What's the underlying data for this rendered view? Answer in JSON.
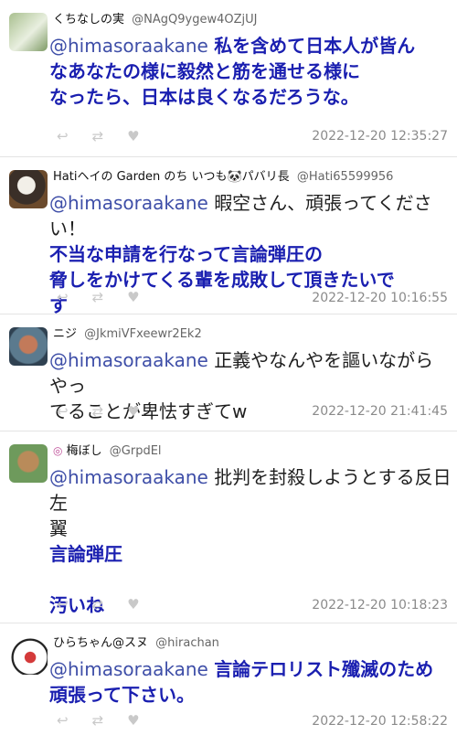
{
  "tweets": [
    {
      "display_name": "くちなしの実",
      "handle": "@NAgQ9ygew4OZjUJ",
      "mention": "@himasoraakane",
      "lines": [
        {
          "bold": true,
          "text": "私を含めて日本人が皆ん"
        },
        {
          "bold": true,
          "text": "なあなたの様に毅然と筋を通せる様に"
        },
        {
          "bold": true,
          "text": "なったら、日本は良くなるだろうな。"
        }
      ],
      "timestamp": "2022-12-20 12:35:27"
    },
    {
      "display_name": "Hatiヘイの Garden のち いつも🐼パバリ長",
      "handle": "@Hati65599956",
      "mention": "@himasoraakane",
      "lines": [
        {
          "bold": false,
          "text": "暇空さん、頑張ってください！"
        },
        {
          "bold": true,
          "text": "不当な申請を行なって言論弾圧の"
        },
        {
          "bold": true,
          "text": "脅しをかけてくる輩を成敗して頂きたいで"
        },
        {
          "bold": true,
          "text": "す"
        }
      ],
      "timestamp": "2022-12-20 10:16:55"
    },
    {
      "display_name": "ニジ",
      "handle": "@JkmiVFxeewr2Ek2",
      "mention": "@himasoraakane",
      "lines": [
        {
          "bold": false,
          "text": "正義やなんやを謳いながらやっ"
        },
        {
          "bold": false,
          "text": "てることが卑怯すぎてw"
        }
      ],
      "timestamp": "2022-12-20 21:41:45"
    },
    {
      "display_name": "梅ぼし",
      "handle": "@GrpdEl",
      "mention": "@himasoraakane",
      "lines": [
        {
          "bold": false,
          "text": "批判を封殺しようとする反日左"
        },
        {
          "bold": false,
          "text": "翼"
        },
        {
          "bold": true,
          "text": "言論弾圧"
        },
        {
          "bold": false,
          "text": ""
        },
        {
          "bold": true,
          "text": "汚いね"
        }
      ],
      "timestamp": "2022-12-20 10:18:23"
    },
    {
      "display_name": "ひらちゃん@スヌ",
      "handle": "@hirachan",
      "mention": "@himasoraakane",
      "lines": [
        {
          "bold": true,
          "text": "言論テロリスト殲滅のため"
        },
        {
          "bold": true,
          "text": "頑張って下さい。"
        }
      ],
      "timestamp": "2022-12-20 12:58:22"
    }
  ],
  "action_icons": [
    "reply-icon",
    "retweet-icon",
    "like-icon"
  ]
}
